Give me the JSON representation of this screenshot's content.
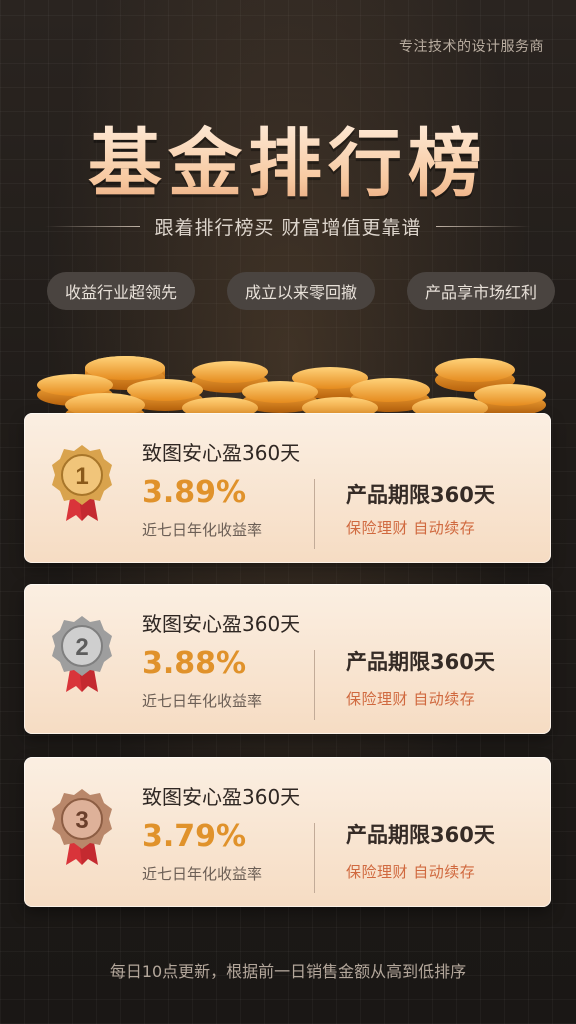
{
  "header": {
    "tagline": "专注技术的设计服务商",
    "title": "基金排行榜",
    "subtitle": "跟着排行榜买 财富增值更靠谱"
  },
  "pills": [
    {
      "label": "收益行业超领先"
    },
    {
      "label": "成立以来零回撤"
    },
    {
      "label": "产品享市场红利"
    }
  ],
  "ranks": [
    {
      "rank": "1",
      "medal": "gold-medal-icon",
      "name": "致图安心盈360天",
      "rate": "3.89%",
      "rate_label": "近七日年化收益率",
      "term": "产品期限360天",
      "features": "保险理财  自动续存"
    },
    {
      "rank": "2",
      "medal": "silver-medal-icon",
      "name": "致图安心盈360天",
      "rate": "3.88%",
      "rate_label": "近七日年化收益率",
      "term": "产品期限360天",
      "features": "保险理财  自动续存"
    },
    {
      "rank": "3",
      "medal": "bronze-medal-icon",
      "name": "致图安心盈360天",
      "rate": "3.79%",
      "rate_label": "近七日年化收益率",
      "term": "产品期限360天",
      "features": "保险理财  自动续存"
    }
  ],
  "footer": {
    "note": "每日10点更新，根据前一日销售金额从高到低排序"
  },
  "colors": {
    "accent": "#e0922b",
    "feature": "#d0693f",
    "gold": "#d9a34d",
    "silver": "#a7a7a7",
    "bronze": "#b9876a",
    "ribbon": "#d9343a"
  }
}
